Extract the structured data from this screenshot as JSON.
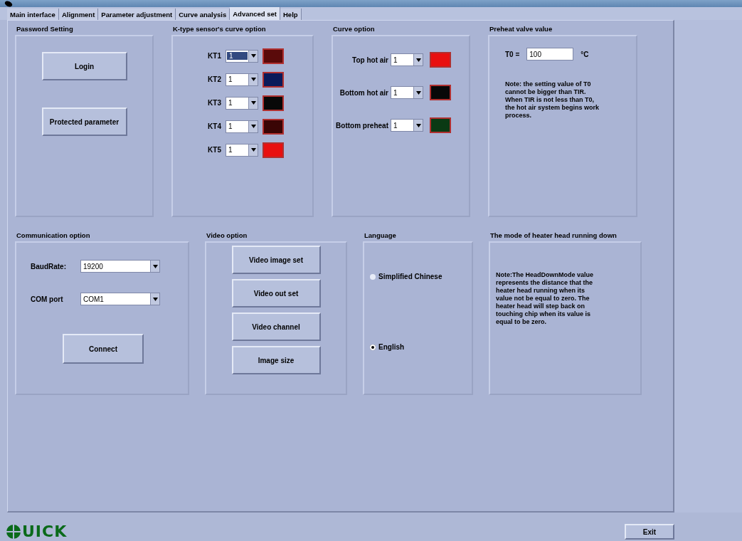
{
  "tabs": [
    {
      "label": "Main interface",
      "selected": false
    },
    {
      "label": "Alignment",
      "selected": false
    },
    {
      "label": "Parameter adjustment",
      "selected": false
    },
    {
      "label": "Curve analysis",
      "selected": false
    },
    {
      "label": "Advanced set",
      "selected": true
    },
    {
      "label": "Help",
      "selected": false
    }
  ],
  "password_setting": {
    "title": "Password Setting",
    "buttons": [
      "Login",
      "Protected parameter"
    ]
  },
  "k_type_curve": {
    "title": "K-type sensor's curve option",
    "rows": [
      {
        "label": "KT1",
        "value": "1",
        "selected": true,
        "color": "#5a0a0a"
      },
      {
        "label": "KT2",
        "value": "1",
        "selected": false,
        "color": "#0a1a5a"
      },
      {
        "label": "KT3",
        "value": "1",
        "selected": false,
        "color": "#080808"
      },
      {
        "label": "KT4",
        "value": "1",
        "selected": false,
        "color": "#3a0505"
      },
      {
        "label": "KT5",
        "value": "1",
        "selected": false,
        "color": "#e81010"
      }
    ]
  },
  "curve_option": {
    "title": "Curve option",
    "rows": [
      {
        "label": "Top hot air",
        "value": "1",
        "color": "#e81010"
      },
      {
        "label": "Bottom hot air",
        "value": "1",
        "color": "#080808"
      },
      {
        "label": "Bottom preheat",
        "value": "1",
        "color": "#0a3a14"
      }
    ]
  },
  "preheat": {
    "title": "Preheat valve value",
    "label": "T0 =",
    "value": "100",
    "unit": "°C",
    "note": "Note: the setting value of T0 cannot be bigger than TIR. When TIR is not less than T0, the hot air system begins work process."
  },
  "communication": {
    "title": "Communication option",
    "fields": [
      {
        "label": "BaudRate:",
        "value": "19200"
      },
      {
        "label": "COM port",
        "value": "COM1"
      }
    ],
    "button": "Connect"
  },
  "video": {
    "title": "Video option",
    "buttons": [
      "Video image set",
      "Video out set",
      "Video channel",
      "Image size"
    ]
  },
  "language": {
    "title": "Language",
    "options": [
      {
        "label": "Simplified Chinese",
        "selected": false
      },
      {
        "label": "English",
        "selected": true
      }
    ]
  },
  "head_mode": {
    "title": "The mode of heater head running down",
    "note": "Note:The HeadDownMode value represents the distance that the heater head running when its value not be equal to zero. The heater head will step back on touching chip when its value is equal to be zero."
  },
  "footer": {
    "logo_text": "UICK",
    "exit_button": "Exit"
  }
}
